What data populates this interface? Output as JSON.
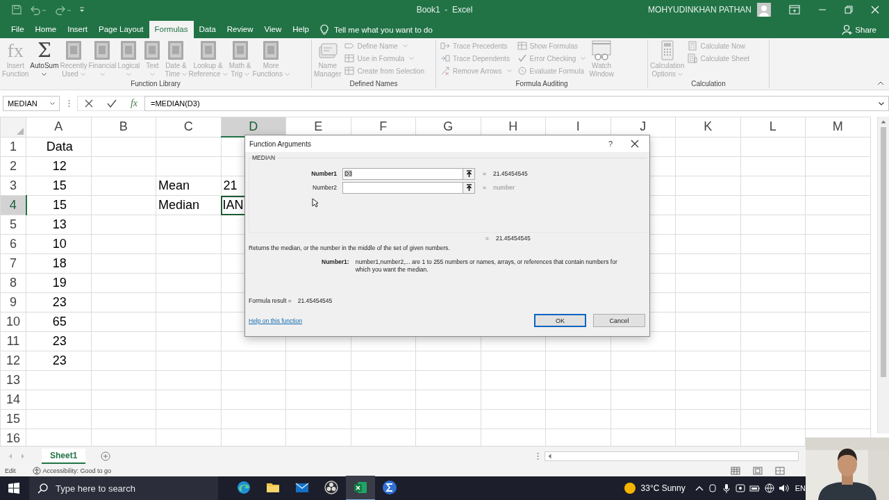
{
  "window": {
    "title": "Book1  -  Excel",
    "user": "MOHYUDINKHAN PATHAN"
  },
  "tabs": [
    {
      "label": "File",
      "selected": false
    },
    {
      "label": "Home",
      "selected": false
    },
    {
      "label": "Insert",
      "selected": false
    },
    {
      "label": "Page Layout",
      "selected": false
    },
    {
      "label": "Formulas",
      "selected": true
    },
    {
      "label": "Data",
      "selected": false
    },
    {
      "label": "Review",
      "selected": false
    },
    {
      "label": "View",
      "selected": false
    },
    {
      "label": "Help",
      "selected": false
    }
  ],
  "tell_me": "Tell me what you want to do",
  "share": "Share",
  "ribbon": {
    "groups": [
      {
        "title": "Function Library",
        "items": [
          {
            "kind": "large",
            "glyph": "fx",
            "label": "Insert\nFunction",
            "disabled": true,
            "menu": false
          },
          {
            "kind": "large",
            "glyph": "Σ",
            "label": "AutoSum",
            "disabled": false,
            "menu": true
          },
          {
            "kind": "large",
            "label": "Recently\nUsed",
            "disabled": true,
            "menu": true
          },
          {
            "kind": "large",
            "label": "Financial",
            "disabled": true,
            "menu": true
          },
          {
            "kind": "large",
            "label": "Logical",
            "disabled": true,
            "menu": true
          },
          {
            "kind": "large",
            "label": "Text",
            "disabled": true,
            "menu": true
          },
          {
            "kind": "large",
            "label": "Date &\nTime",
            "disabled": true,
            "menu": true
          },
          {
            "kind": "large",
            "label": "Lookup &\nReference",
            "disabled": true,
            "menu": true
          },
          {
            "kind": "large",
            "label": "Math &\nTrig",
            "disabled": true,
            "menu": true
          },
          {
            "kind": "large",
            "label": "More\nFunctions",
            "disabled": true,
            "menu": true
          }
        ]
      },
      {
        "title": "Defined Names",
        "items": [
          {
            "kind": "large",
            "label": "Name\nManager",
            "disabled": true,
            "menu": false
          },
          {
            "kind": "small",
            "label": "Define Name",
            "disabled": true,
            "menu": true
          },
          {
            "kind": "small",
            "label": "Use in Formula",
            "disabled": true,
            "menu": true
          },
          {
            "kind": "small",
            "label": "Create from Selection",
            "disabled": true,
            "menu": false
          }
        ]
      },
      {
        "title": "Formula Auditing",
        "items": [
          {
            "kind": "small",
            "label": "Trace Precedents",
            "disabled": true,
            "menu": false
          },
          {
            "kind": "small",
            "label": "Trace Dependents",
            "disabled": true,
            "menu": false
          },
          {
            "kind": "small",
            "label": "Remove Arrows",
            "disabled": true,
            "menu": true
          },
          {
            "kind": "small",
            "label": "Show Formulas",
            "disabled": true,
            "menu": false
          },
          {
            "kind": "small",
            "label": "Error Checking",
            "disabled": true,
            "menu": true
          },
          {
            "kind": "small",
            "label": "Evaluate Formula",
            "disabled": true,
            "menu": false
          },
          {
            "kind": "large",
            "label": "Watch\nWindow",
            "disabled": true,
            "menu": false
          }
        ]
      },
      {
        "title": "Calculation",
        "items": [
          {
            "kind": "large",
            "label": "Calculation\nOptions",
            "disabled": true,
            "menu": true
          },
          {
            "kind": "small",
            "label": "Calculate Now",
            "disabled": true,
            "menu": false
          },
          {
            "kind": "small",
            "label": "Calculate Sheet",
            "disabled": true,
            "menu": false
          }
        ]
      }
    ]
  },
  "formula_bar": {
    "name_box": "MEDIAN",
    "function_glyph": "fx",
    "formula": "=MEDIAN(D3)"
  },
  "sheet": {
    "columns": [
      {
        "label": "A",
        "selected": false
      },
      {
        "label": "B",
        "selected": false
      },
      {
        "label": "C",
        "selected": false
      },
      {
        "label": "D",
        "selected": true
      },
      {
        "label": "E",
        "selected": false
      },
      {
        "label": "F",
        "selected": false
      },
      {
        "label": "G",
        "selected": false
      },
      {
        "label": "H",
        "selected": false
      },
      {
        "label": "I",
        "selected": false
      },
      {
        "label": "J",
        "selected": false
      },
      {
        "label": "K",
        "selected": false
      },
      {
        "label": "L",
        "selected": false
      },
      {
        "label": "M",
        "selected": false
      }
    ],
    "rows": [
      {
        "number": "1",
        "selected": false,
        "cells": {
          "A": "Data"
        }
      },
      {
        "number": "2",
        "selected": false,
        "cells": {
          "A": "12"
        }
      },
      {
        "number": "3",
        "selected": false,
        "cells": {
          "A": "15",
          "C": "Mean",
          "D": "21"
        }
      },
      {
        "number": "4",
        "selected": true,
        "cells": {
          "A": "15",
          "C": "Median",
          "D": "IAN"
        }
      },
      {
        "number": "5",
        "selected": false,
        "cells": {
          "A": "13"
        }
      },
      {
        "number": "6",
        "selected": false,
        "cells": {
          "A": "10"
        }
      },
      {
        "number": "7",
        "selected": false,
        "cells": {
          "A": "18"
        }
      },
      {
        "number": "8",
        "selected": false,
        "cells": {
          "A": "19"
        }
      },
      {
        "number": "9",
        "selected": false,
        "cells": {
          "A": "23"
        }
      },
      {
        "number": "10",
        "selected": false,
        "cells": {
          "A": "65"
        }
      },
      {
        "number": "11",
        "selected": false,
        "cells": {
          "A": "23"
        }
      },
      {
        "number": "12",
        "selected": false,
        "cells": {
          "A": "23"
        }
      },
      {
        "number": "13",
        "selected": false,
        "cells": {}
      },
      {
        "number": "14",
        "selected": false,
        "cells": {}
      },
      {
        "number": "15",
        "selected": false,
        "cells": {}
      },
      {
        "number": "16",
        "selected": false,
        "cells": {}
      }
    ]
  },
  "dialog": {
    "title": "Function Arguments",
    "help_glyph": "?",
    "function": "MEDIAN",
    "arguments": [
      {
        "label": "Number1",
        "value": "D3",
        "equals": "=",
        "result": "21.45454545",
        "active": true
      },
      {
        "label": "Number2",
        "equals": "=",
        "result": "number",
        "active": false
      }
    ],
    "total_equals": "=",
    "total_result": "21.45454545",
    "description": "Returns the median, or the number in the middle of the set of given numbers.",
    "arg_help_label": "Number1:",
    "arg_help": "number1,number2,... are 1 to 255 numbers or names, arrays, or references that contain numbers for which you want the median.",
    "formula_result_label": "Formula result =",
    "formula_result": "21.45454545",
    "help_link": "Help on this function",
    "buttons": [
      {
        "label": "OK",
        "default": true
      },
      {
        "label": "Cancel",
        "default": false
      }
    ]
  },
  "sheet_tabs": [
    {
      "label": "Sheet1",
      "selected": true
    }
  ],
  "status_bar": {
    "mode": "Edit",
    "accessibility": "Accessibility: Good to go"
  },
  "taskbar": {
    "search_placeholder": "Type here to search",
    "apps": [
      {
        "active": false
      },
      {
        "active": false
      },
      {
        "active": false
      },
      {
        "active": false
      },
      {
        "active": true
      },
      {
        "active": false
      }
    ],
    "weather": "33°C  Sunny",
    "language": "EN"
  }
}
